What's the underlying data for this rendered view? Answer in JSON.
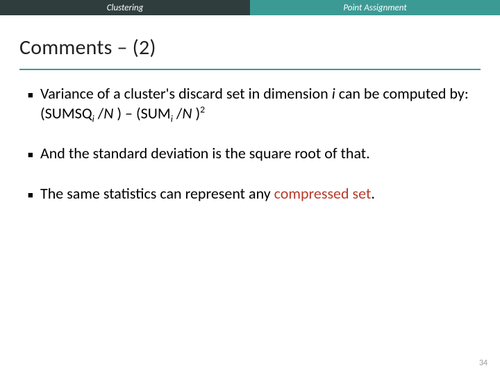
{
  "tabs": {
    "left": "Clustering",
    "right": "Point Assignment"
  },
  "title": "Comments – (2)",
  "bullets": {
    "b1_lead": "Variance of a cluster's discard set in dimension ",
    "b1_i": "i",
    "b1_mid": "  can be computed by:    (SUMSQ",
    "b1_sub1": "i",
    "b1_frac1a": " /",
    "b1_N1": "N",
    "b1_frac1b": " ) – (SUM",
    "b1_sub2": "i",
    "b1_frac2a": " /",
    "b1_N2": "N",
    "b1_frac2b": " )",
    "b1_sup": "2",
    "b2": "And the standard deviation is the square root of that.",
    "b3_a": "The same statistics can represent any ",
    "b3_red1": "compressed",
    "b3_b": " ",
    "b3_red2": "set",
    "b3_c": "."
  },
  "pagenum": "34"
}
